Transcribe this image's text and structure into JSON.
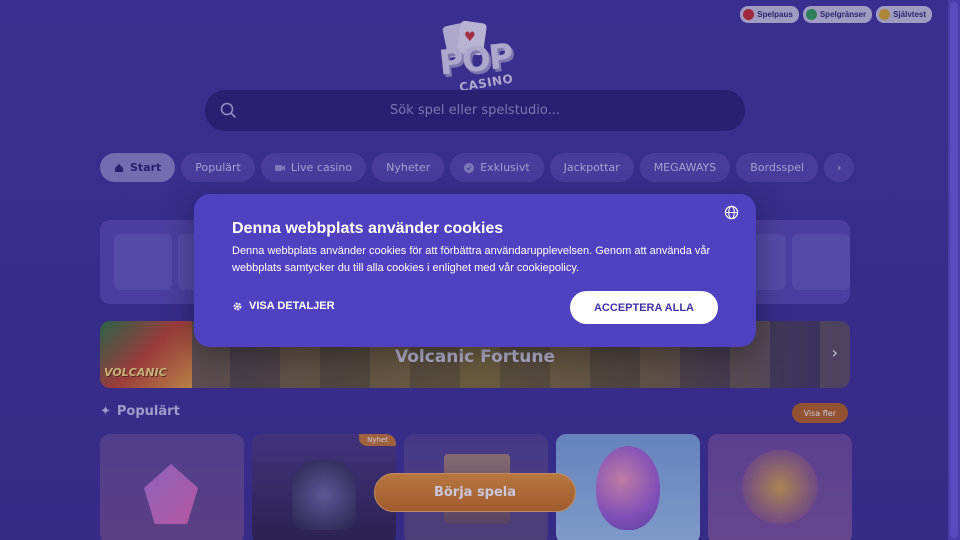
{
  "top_links": [
    {
      "label": "Spelpaus",
      "icon": "pause-icon",
      "color": "#c62a2a"
    },
    {
      "label": "Spelgränser",
      "icon": "limits-icon",
      "color": "#2f9e52"
    },
    {
      "label": "Självtest",
      "icon": "selftest-icon",
      "color": "#d9a826"
    }
  ],
  "logo": {
    "pop": "POP",
    "casino": "CASINO"
  },
  "search": {
    "placeholder": "Sök spel eller spelstudio..."
  },
  "nav": {
    "tabs": [
      {
        "label": "Start",
        "icon": "home-icon",
        "active": true
      },
      {
        "label": "Populärt"
      },
      {
        "label": "Live casino",
        "icon": "camera-icon"
      },
      {
        "label": "Nyheter"
      },
      {
        "label": "Exklusivt",
        "icon": "badge-icon"
      },
      {
        "label": "Jackpottar"
      },
      {
        "label": "MEGAWAYS"
      },
      {
        "label": "Bordsspel"
      }
    ]
  },
  "banner": {
    "title": "Volcanic Fortune",
    "thumb_label": "VOLCANIC"
  },
  "popular": {
    "heading": "Populärt",
    "more_label": "Visa fler",
    "badge_new": "Nyhet"
  },
  "cta": {
    "label": "Börja spela"
  },
  "cookie": {
    "title": "Denna webbplats använder cookies",
    "body": "Denna webbplats använder cookies för att förbättra användarupplevelsen. Genom att använda vår webbplats samtycker du till alla cookies i enlighet med vår cookiepolicy.",
    "details_label": "VISA DETALJER",
    "accept_label": "ACCEPTERA ALLA"
  },
  "colors": {
    "background": "#3c2f93",
    "dialog": "#5041c0",
    "cta": "#e8952e",
    "accent_orange": "#b7641e"
  }
}
